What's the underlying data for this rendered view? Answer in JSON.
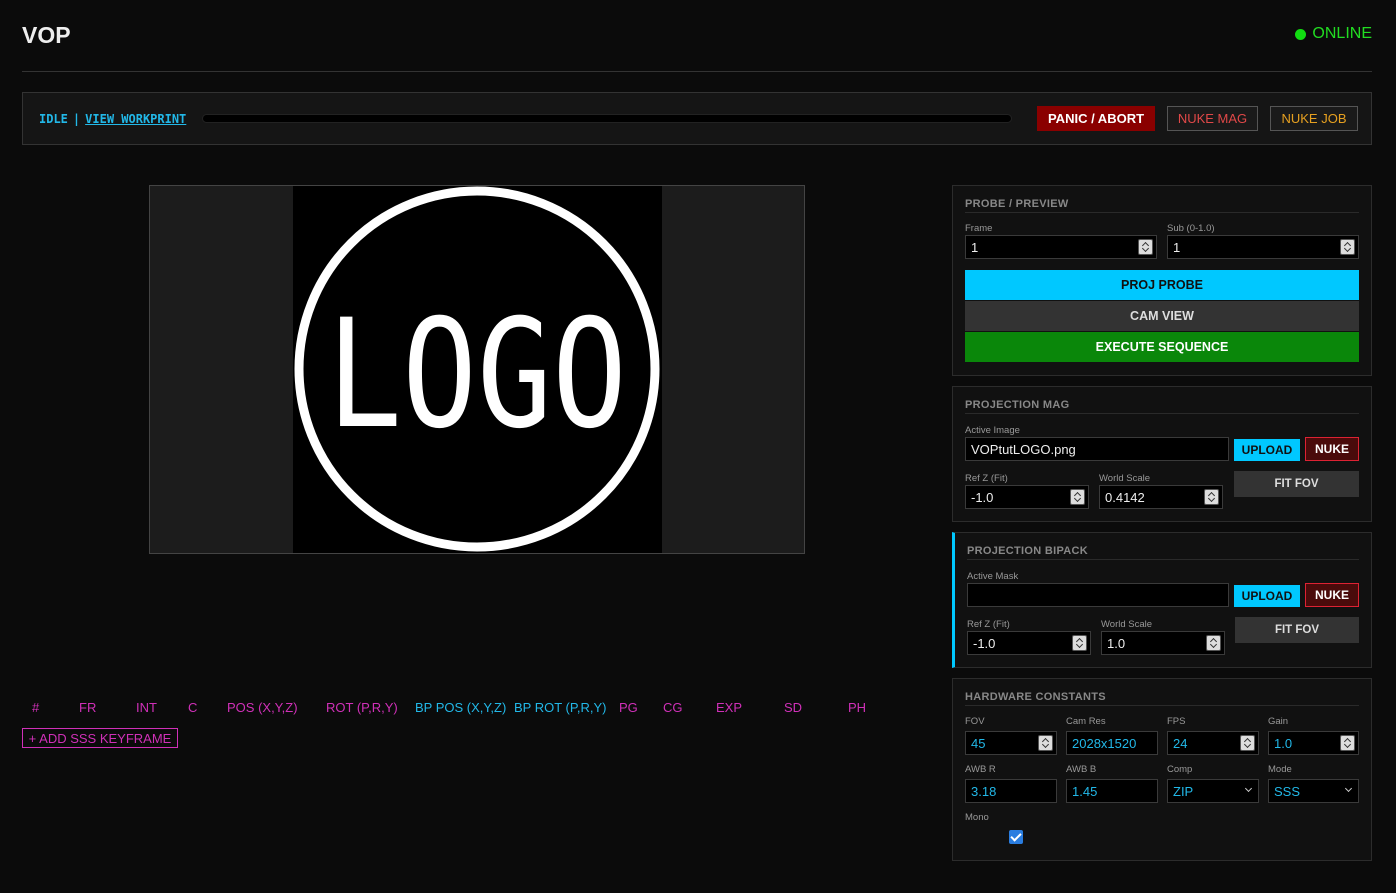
{
  "header": {
    "title": "VOP",
    "status": "ONLINE",
    "status_color": "#11dd11"
  },
  "control": {
    "state": "IDLE",
    "separator": "|",
    "view_workprint": "VIEW WORKPRINT",
    "progress": 0,
    "panic_label": "PANIC / ABORT",
    "nuke_mag_label": "NUKE MAG",
    "nuke_job_label": "NUKE JOB"
  },
  "preview": {
    "image_text": "LOGO"
  },
  "keyframes": {
    "columns": [
      "#",
      "FR",
      "INT",
      "C",
      "POS (X,Y,Z)",
      "ROT (P,R,Y)",
      "BP POS (X,Y,Z)",
      "BP ROT (P,R,Y)",
      "PG",
      "CG",
      "EXP",
      "SD",
      "PH"
    ],
    "add_label": "+ ADD SSS KEYFRAME"
  },
  "probe": {
    "title": "PROBE / PREVIEW",
    "frame_label": "Frame",
    "frame_value": "1",
    "sub_label": "Sub (0-1.0)",
    "sub_value": "1",
    "proj_probe": "PROJ PROBE",
    "cam_view": "CAM VIEW",
    "execute": "EXECUTE SEQUENCE"
  },
  "proj_mag": {
    "title": "PROJECTION MAG",
    "active_label": "Active Image",
    "active_value": "VOPtutLOGO.png",
    "upload": "UPLOAD",
    "nuke": "NUKE",
    "refz_label": "Ref Z (Fit)",
    "refz_value": "-1.0",
    "scale_label": "World Scale",
    "scale_value": "0.4142",
    "fit_fov": "FIT FOV"
  },
  "bipack": {
    "title": "PROJECTION BIPACK",
    "active_label": "Active Mask",
    "active_value": "",
    "upload": "UPLOAD",
    "nuke": "NUKE",
    "refz_label": "Ref Z (Fit)",
    "refz_value": "-1.0",
    "scale_label": "World Scale",
    "scale_value": "1.0",
    "fit_fov": "FIT FOV"
  },
  "hardware": {
    "title": "HARDWARE CONSTANTS",
    "fov_label": "FOV",
    "fov_value": "45",
    "camres_label": "Cam Res",
    "camres_value": "2028x1520",
    "fps_label": "FPS",
    "fps_value": "24",
    "gain_label": "Gain",
    "gain_value": "1.0",
    "awbr_label": "AWB R",
    "awbr_value": "3.18",
    "awbb_label": "AWB B",
    "awbb_value": "1.45",
    "comp_label": "Comp",
    "comp_value": "ZIP",
    "mode_label": "Mode",
    "mode_value": "SSS",
    "mono_label": "Mono",
    "mono_checked": true
  }
}
